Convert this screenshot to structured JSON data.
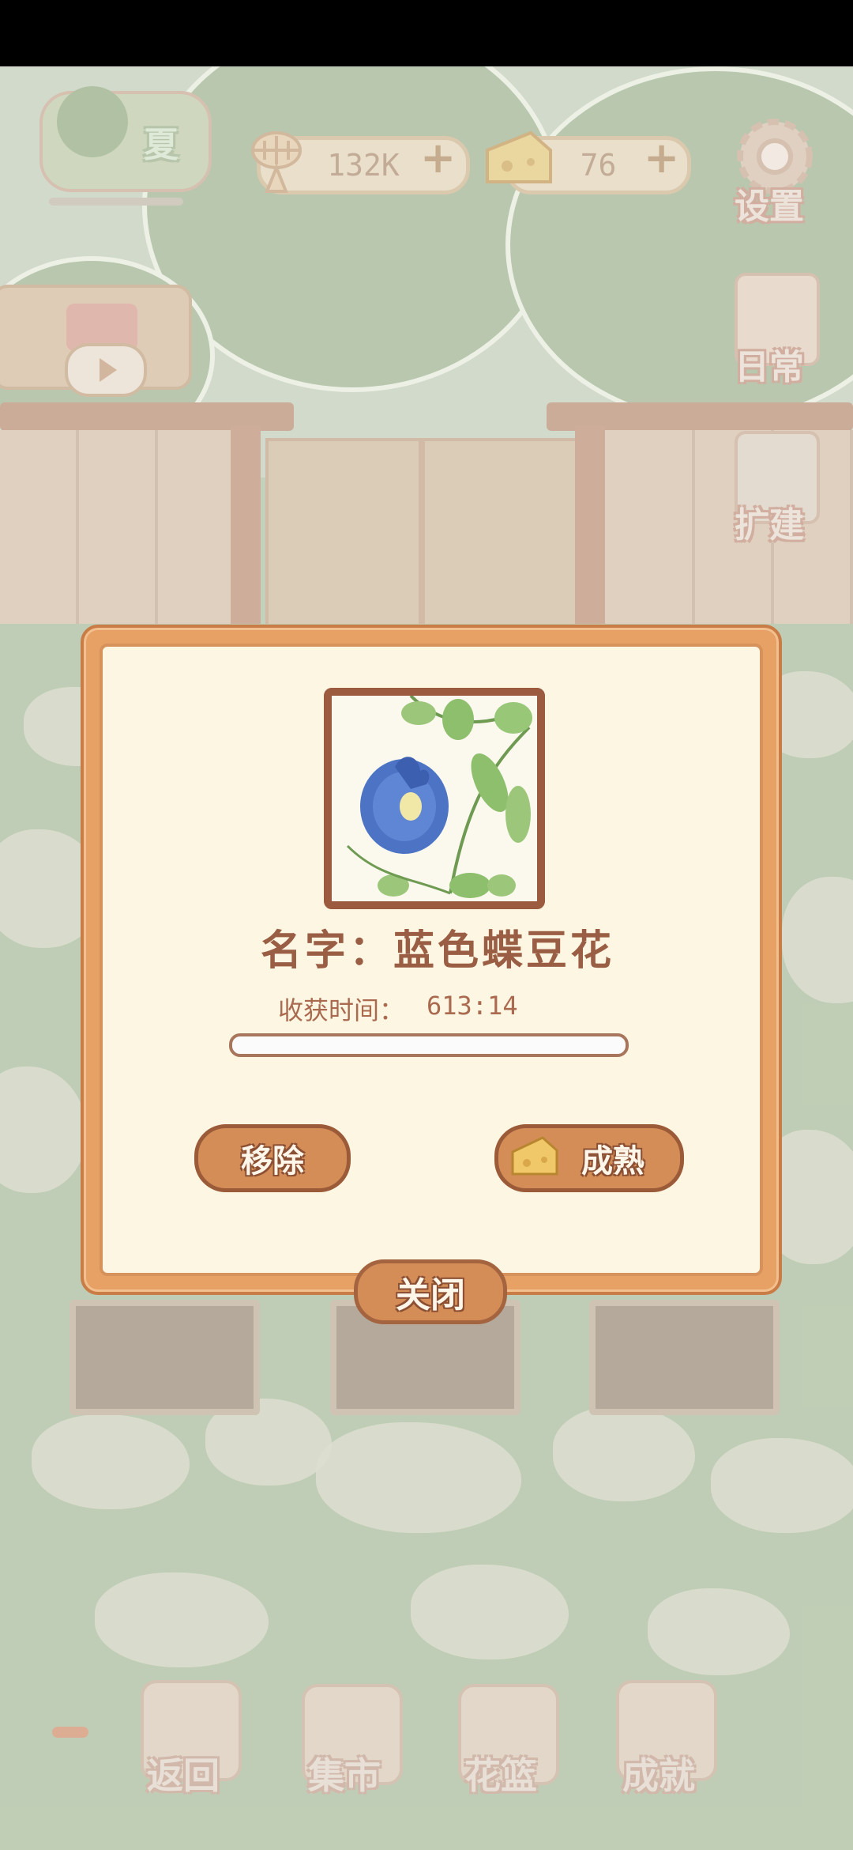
{
  "hud": {
    "season_label": "夏",
    "fish_currency": "132K",
    "cheese_currency": "76",
    "settings_label": "设置",
    "daily_label": "日常",
    "expand_label": "扩建"
  },
  "dialog": {
    "name_text": "名字：蓝色蝶豆花",
    "harvest_time_label": "收获时间：",
    "harvest_time_value": "613:14",
    "progress_fraction": 0.0,
    "remove_label": "移除",
    "mature_label": "成熟",
    "close_label": "关闭"
  },
  "bottom_nav": {
    "back_label": "返回",
    "market_label": "集市",
    "basket_label": "花篮",
    "achievement_label": "成就"
  }
}
